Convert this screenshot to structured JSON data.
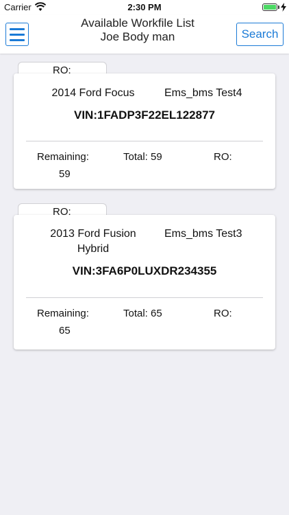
{
  "status_bar": {
    "carrier": "Carrier",
    "time": "2:30 PM"
  },
  "nav": {
    "title_line1": "Available Workfile List",
    "title_line2": "Joe Body man",
    "search_label": "Search",
    "menu_icon": "hamburger-menu-icon"
  },
  "workfiles": [
    {
      "ro_tab": "RO:",
      "vehicle_line1": "2014 Ford Focus",
      "vehicle_line2": "",
      "estimator": "Ems_bms Test4",
      "vin": "VIN:1FADP3F22EL122877",
      "remaining_label": "Remaining:",
      "remaining_value": "59",
      "total_label": "Total: 59",
      "ro_label": "RO:"
    },
    {
      "ro_tab": "RO:",
      "vehicle_line1": "2013 Ford Fusion",
      "vehicle_line2": "Hybrid",
      "estimator": "Ems_bms Test3",
      "vin": "VIN:3FA6P0LUXDR234355",
      "remaining_label": "Remaining:",
      "remaining_value": "65",
      "total_label": "Total: 65",
      "ro_label": "RO:"
    }
  ]
}
